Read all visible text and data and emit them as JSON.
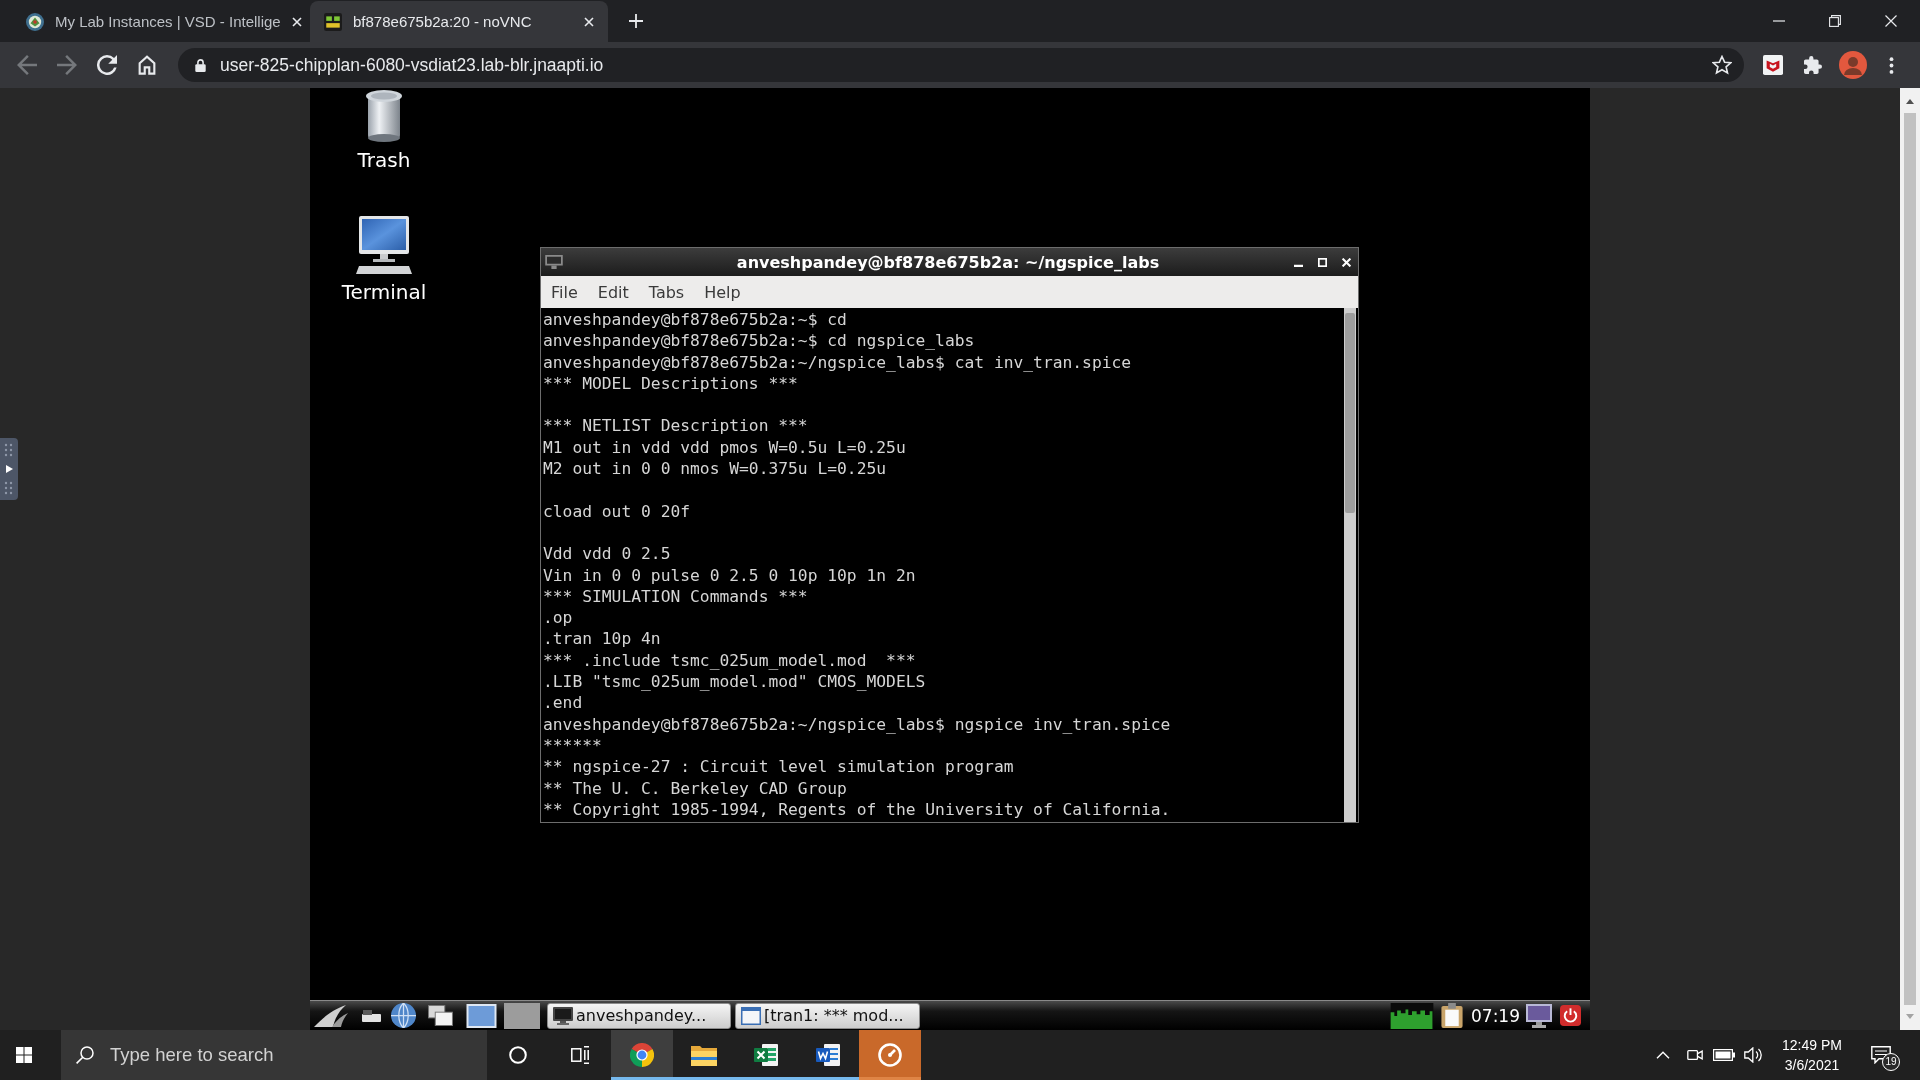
{
  "browser": {
    "tabs": [
      {
        "title": "My Lab Instances | VSD - Intellige",
        "selected": false
      },
      {
        "title": "bf878e675b2a:20 - noVNC",
        "selected": true
      }
    ],
    "url": "user-825-chipplan-6080-vsdiat23.lab-blr.jnaapti.io"
  },
  "remote_desktop": {
    "desktop_icons": [
      {
        "label": "Trash",
        "kind": "trash"
      },
      {
        "label": "Terminal",
        "kind": "terminal"
      }
    ],
    "terminal_window": {
      "title": "anveshpandey@bf878e675b2a: ~/ngspice_labs",
      "menu": [
        "File",
        "Edit",
        "Tabs",
        "Help"
      ],
      "blocks": [
        [
          "anveshpandey@bf878e675b2a:~$ cd",
          "anveshpandey@bf878e675b2a:~$ cd ngspice_labs",
          "anveshpandey@bf878e675b2a:~/ngspice_labs$ cat inv_tran.spice",
          "*** MODEL Descriptions ***"
        ],
        [
          "*** NETLIST Description ***",
          "M1 out in vdd vdd pmos W=0.5u L=0.25u",
          "M2 out in 0 0 nmos W=0.375u L=0.25u"
        ],
        [
          "cload out 0 20f"
        ],
        [
          "Vdd vdd 0 2.5",
          "Vin in 0 0 pulse 0 2.5 0 10p 10p 1n 2n",
          "*** SIMULATION Commands ***",
          ".op",
          ".tran 10p 4n",
          "*** .include tsmc_025um_model.mod  ***",
          ".LIB \"tsmc_025um_model.mod\" CMOS_MODELS",
          ".end",
          "anveshpandey@bf878e675b2a:~/ngspice_labs$ ngspice inv_tran.spice",
          "******",
          "** ngspice-27 : Circuit level simulation program",
          "** The U. C. Berkeley CAD Group",
          "** Copyright 1985-1994, Regents of the University of California."
        ]
      ]
    },
    "panel": {
      "tasks": [
        {
          "label": "anveshpandey...",
          "kind": "terminal"
        },
        {
          "label": "[tran1: *** mod...",
          "kind": "window"
        }
      ],
      "clock": "07:19"
    }
  },
  "taskbar": {
    "search": {
      "placeholder": "Type here to search"
    },
    "apps": [
      {
        "kind": "browser",
        "selected": true,
        "running": true,
        "flashing": false
      },
      {
        "kind": "folder",
        "selected": false,
        "running": true,
        "flashing": false
      },
      {
        "kind": "spreadsheet",
        "selected": false,
        "running": true,
        "flashing": false
      },
      {
        "kind": "document",
        "selected": false,
        "running": true,
        "flashing": false
      },
      {
        "kind": "gauge",
        "selected": false,
        "running": true,
        "flashing": true
      }
    ],
    "time": "12:49 PM",
    "date": "3/6/2021",
    "notification_count": "19"
  }
}
